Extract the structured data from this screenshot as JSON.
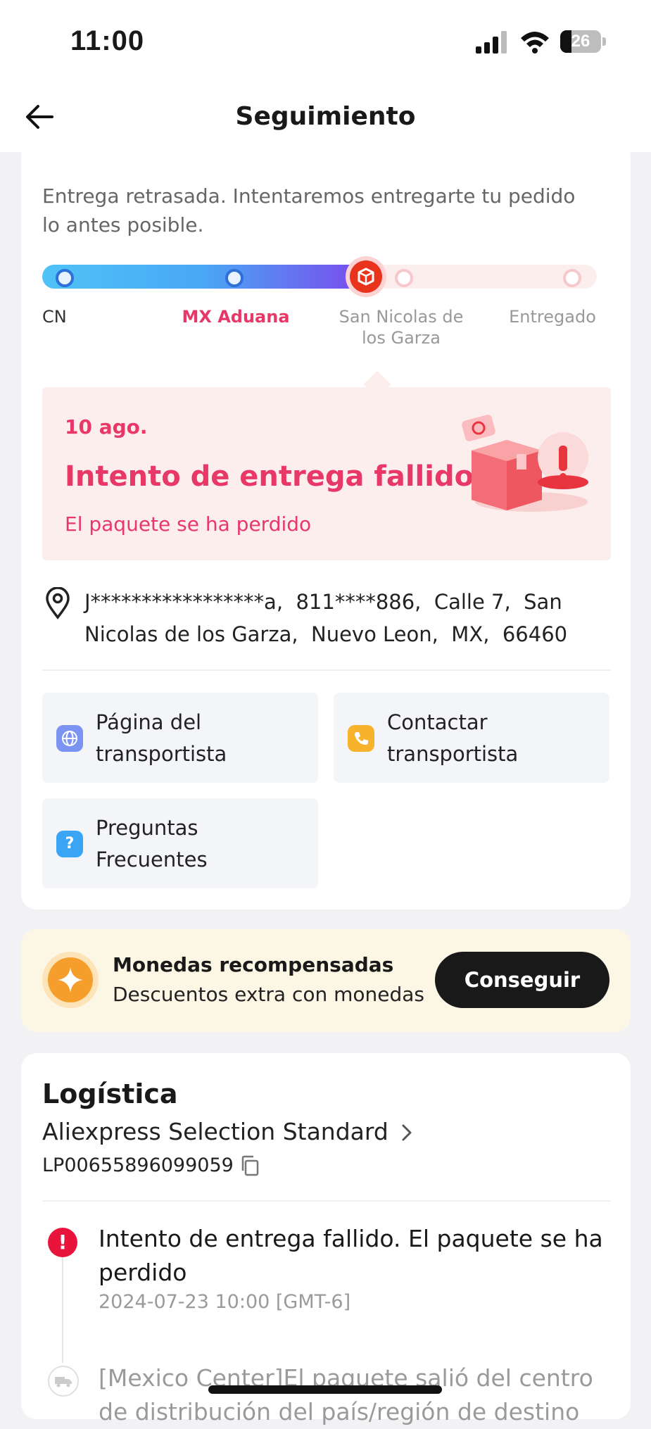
{
  "status_bar": {
    "time": "11:00",
    "battery": "26"
  },
  "nav": {
    "title": "Seguimiento",
    "back_icon": "arrow-left-icon"
  },
  "delay_notice": "Entrega retrasada. Intentaremos entregarte tu pedido lo antes posible.",
  "progress": {
    "stages": [
      "CN",
      "MX Aduana",
      "San Nicolas de los Garza",
      "Entregado"
    ],
    "current_stage": "San Nicolas de los Garza",
    "colors": {
      "active_label": "#e83868",
      "current_dot": "#e8341c"
    }
  },
  "status_card": {
    "date": "10 ago.",
    "title": "Intento de entrega fallido",
    "subtitle": "El paquete se ha perdido"
  },
  "address": "J*****************a,  811****886,  Calle 7,  San Nicolas de los Garza,  Nuevo Leon,  MX,  66460",
  "actions": [
    {
      "label": "Página del\ntransportista",
      "icon": "globe-icon"
    },
    {
      "label": "Contactar\ntransportista",
      "icon": "phone-icon"
    },
    {
      "label": "Preguntas\nFrecuentes",
      "icon": "question-icon"
    }
  ],
  "coins": {
    "title": "Monedas recompensadas",
    "subtitle": "Descuentos extra con monedas",
    "button": "Conseguir"
  },
  "logistics": {
    "heading": "Logística",
    "carrier": "Aliexpress Selection Standard",
    "tracking_number": "LP00655896099059",
    "events": [
      {
        "title": "Intento de entrega fallido. El paquete se ha perdido",
        "time": "2024-07-23 10:00 [GMT-6]"
      },
      {
        "title": "[Mexico Center]El paquete salió del centro de distribución del país/región de destino"
      }
    ]
  }
}
